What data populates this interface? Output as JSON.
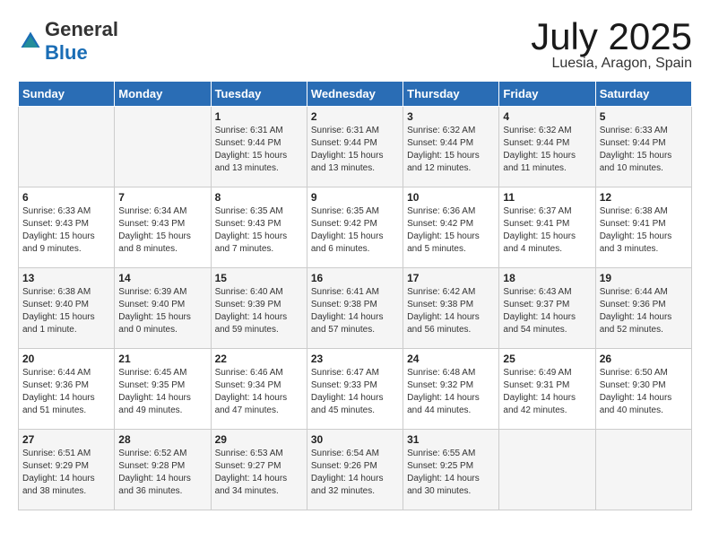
{
  "logo": {
    "general": "General",
    "blue": "Blue"
  },
  "header": {
    "month": "July 2025",
    "location": "Luesia, Aragon, Spain"
  },
  "weekdays": [
    "Sunday",
    "Monday",
    "Tuesday",
    "Wednesday",
    "Thursday",
    "Friday",
    "Saturday"
  ],
  "weeks": [
    [
      {
        "day": "",
        "info": ""
      },
      {
        "day": "",
        "info": ""
      },
      {
        "day": "1",
        "sunrise": "6:31 AM",
        "sunset": "9:44 PM",
        "daylight": "15 hours and 13 minutes."
      },
      {
        "day": "2",
        "sunrise": "6:31 AM",
        "sunset": "9:44 PM",
        "daylight": "15 hours and 13 minutes."
      },
      {
        "day": "3",
        "sunrise": "6:32 AM",
        "sunset": "9:44 PM",
        "daylight": "15 hours and 12 minutes."
      },
      {
        "day": "4",
        "sunrise": "6:32 AM",
        "sunset": "9:44 PM",
        "daylight": "15 hours and 11 minutes."
      },
      {
        "day": "5",
        "sunrise": "6:33 AM",
        "sunset": "9:44 PM",
        "daylight": "15 hours and 10 minutes."
      }
    ],
    [
      {
        "day": "6",
        "sunrise": "6:33 AM",
        "sunset": "9:43 PM",
        "daylight": "15 hours and 9 minutes."
      },
      {
        "day": "7",
        "sunrise": "6:34 AM",
        "sunset": "9:43 PM",
        "daylight": "15 hours and 8 minutes."
      },
      {
        "day": "8",
        "sunrise": "6:35 AM",
        "sunset": "9:43 PM",
        "daylight": "15 hours and 7 minutes."
      },
      {
        "day": "9",
        "sunrise": "6:35 AM",
        "sunset": "9:42 PM",
        "daylight": "15 hours and 6 minutes."
      },
      {
        "day": "10",
        "sunrise": "6:36 AM",
        "sunset": "9:42 PM",
        "daylight": "15 hours and 5 minutes."
      },
      {
        "day": "11",
        "sunrise": "6:37 AM",
        "sunset": "9:41 PM",
        "daylight": "15 hours and 4 minutes."
      },
      {
        "day": "12",
        "sunrise": "6:38 AM",
        "sunset": "9:41 PM",
        "daylight": "15 hours and 3 minutes."
      }
    ],
    [
      {
        "day": "13",
        "sunrise": "6:38 AM",
        "sunset": "9:40 PM",
        "daylight": "15 hours and 1 minute."
      },
      {
        "day": "14",
        "sunrise": "6:39 AM",
        "sunset": "9:40 PM",
        "daylight": "15 hours and 0 minutes."
      },
      {
        "day": "15",
        "sunrise": "6:40 AM",
        "sunset": "9:39 PM",
        "daylight": "14 hours and 59 minutes."
      },
      {
        "day": "16",
        "sunrise": "6:41 AM",
        "sunset": "9:38 PM",
        "daylight": "14 hours and 57 minutes."
      },
      {
        "day": "17",
        "sunrise": "6:42 AM",
        "sunset": "9:38 PM",
        "daylight": "14 hours and 56 minutes."
      },
      {
        "day": "18",
        "sunrise": "6:43 AM",
        "sunset": "9:37 PM",
        "daylight": "14 hours and 54 minutes."
      },
      {
        "day": "19",
        "sunrise": "6:44 AM",
        "sunset": "9:36 PM",
        "daylight": "14 hours and 52 minutes."
      }
    ],
    [
      {
        "day": "20",
        "sunrise": "6:44 AM",
        "sunset": "9:36 PM",
        "daylight": "14 hours and 51 minutes."
      },
      {
        "day": "21",
        "sunrise": "6:45 AM",
        "sunset": "9:35 PM",
        "daylight": "14 hours and 49 minutes."
      },
      {
        "day": "22",
        "sunrise": "6:46 AM",
        "sunset": "9:34 PM",
        "daylight": "14 hours and 47 minutes."
      },
      {
        "day": "23",
        "sunrise": "6:47 AM",
        "sunset": "9:33 PM",
        "daylight": "14 hours and 45 minutes."
      },
      {
        "day": "24",
        "sunrise": "6:48 AM",
        "sunset": "9:32 PM",
        "daylight": "14 hours and 44 minutes."
      },
      {
        "day": "25",
        "sunrise": "6:49 AM",
        "sunset": "9:31 PM",
        "daylight": "14 hours and 42 minutes."
      },
      {
        "day": "26",
        "sunrise": "6:50 AM",
        "sunset": "9:30 PM",
        "daylight": "14 hours and 40 minutes."
      }
    ],
    [
      {
        "day": "27",
        "sunrise": "6:51 AM",
        "sunset": "9:29 PM",
        "daylight": "14 hours and 38 minutes."
      },
      {
        "day": "28",
        "sunrise": "6:52 AM",
        "sunset": "9:28 PM",
        "daylight": "14 hours and 36 minutes."
      },
      {
        "day": "29",
        "sunrise": "6:53 AM",
        "sunset": "9:27 PM",
        "daylight": "14 hours and 34 minutes."
      },
      {
        "day": "30",
        "sunrise": "6:54 AM",
        "sunset": "9:26 PM",
        "daylight": "14 hours and 32 minutes."
      },
      {
        "day": "31",
        "sunrise": "6:55 AM",
        "sunset": "9:25 PM",
        "daylight": "14 hours and 30 minutes."
      },
      {
        "day": "",
        "info": ""
      },
      {
        "day": "",
        "info": ""
      }
    ]
  ],
  "labels": {
    "sunrise": "Sunrise:",
    "sunset": "Sunset:",
    "daylight": "Daylight:"
  }
}
